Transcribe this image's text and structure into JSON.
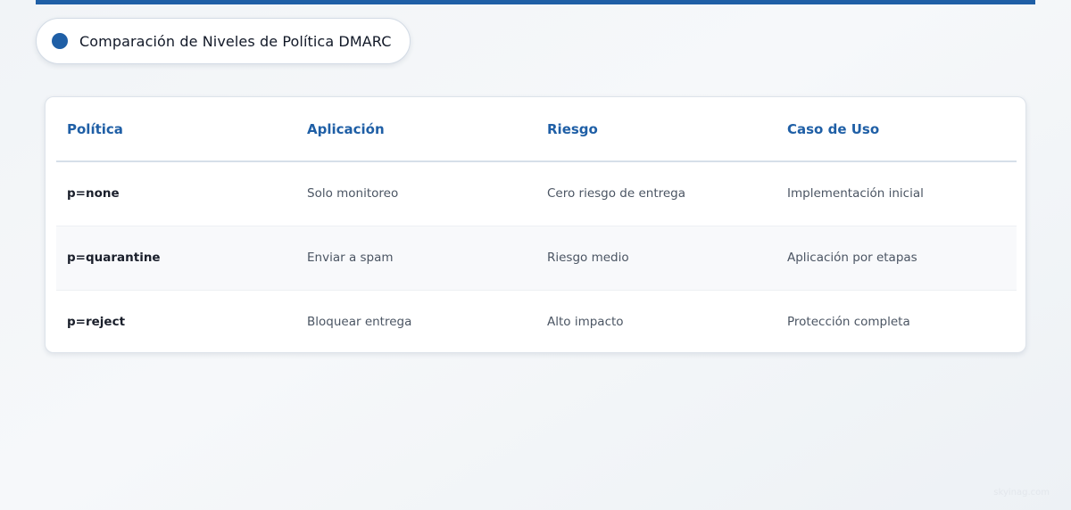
{
  "header": {
    "title": "Comparación de Niveles de Política DMARC",
    "accent_color": "#1f5fa6"
  },
  "table": {
    "columns": [
      "Política",
      "Aplicación",
      "Riesgo",
      "Caso de Uso"
    ],
    "rows": [
      [
        "p=none",
        "Solo monitoreo",
        "Cero riesgo de entrega",
        "Implementación inicial"
      ],
      [
        "p=quarantine",
        "Enviar a spam",
        "Riesgo medio",
        "Aplicación por etapas"
      ],
      [
        "p=reject",
        "Bloquear entrega",
        "Alto impacto",
        "Protección completa"
      ]
    ]
  },
  "watermark": "skyinag.com"
}
